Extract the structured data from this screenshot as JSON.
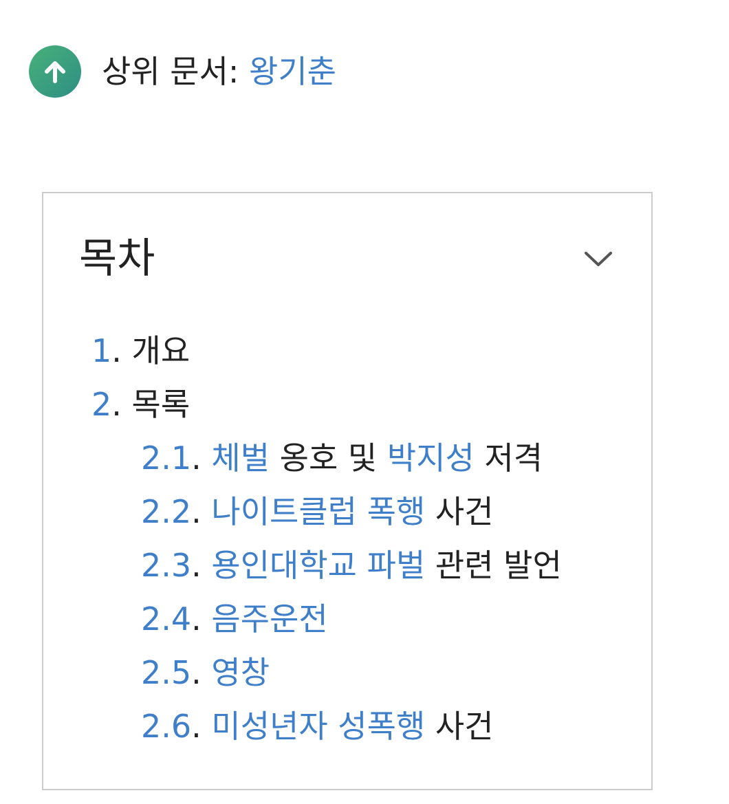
{
  "parent": {
    "icon": "arrow-up-circle-icon",
    "prefix": "상위 문서: ",
    "link": "왕기춘"
  },
  "toc": {
    "title": "목차",
    "toggle_icon": "chevron-down-icon",
    "items": [
      {
        "level": 1,
        "number": "1",
        "segments": [
          {
            "text": "개요",
            "link": false
          }
        ]
      },
      {
        "level": 1,
        "number": "2",
        "segments": [
          {
            "text": "목록",
            "link": false
          }
        ]
      },
      {
        "level": 2,
        "number": "2.1",
        "segments": [
          {
            "text": "체벌",
            "link": true
          },
          {
            "text": " 옹호 및 ",
            "link": false
          },
          {
            "text": "박지성",
            "link": true
          },
          {
            "text": " 저격",
            "link": false
          }
        ]
      },
      {
        "level": 2,
        "number": "2.2",
        "segments": [
          {
            "text": "나이트클럽 폭행",
            "link": true
          },
          {
            "text": " 사건",
            "link": false
          }
        ]
      },
      {
        "level": 2,
        "number": "2.3",
        "segments": [
          {
            "text": "용인대학교 파벌",
            "link": true
          },
          {
            "text": " 관련 발언",
            "link": false
          }
        ]
      },
      {
        "level": 2,
        "number": "2.4",
        "segments": [
          {
            "text": "음주운전",
            "link": true
          }
        ]
      },
      {
        "level": 2,
        "number": "2.5",
        "segments": [
          {
            "text": "영창",
            "link": true
          }
        ]
      },
      {
        "level": 2,
        "number": "2.6",
        "segments": [
          {
            "text": "미성년자 성폭행",
            "link": true
          },
          {
            "text": " 사건",
            "link": false
          }
        ]
      }
    ]
  },
  "colors": {
    "link": "#3f7fc9",
    "text": "#222222",
    "border": "#cccccc",
    "icon_green": "#3a9e7f"
  }
}
